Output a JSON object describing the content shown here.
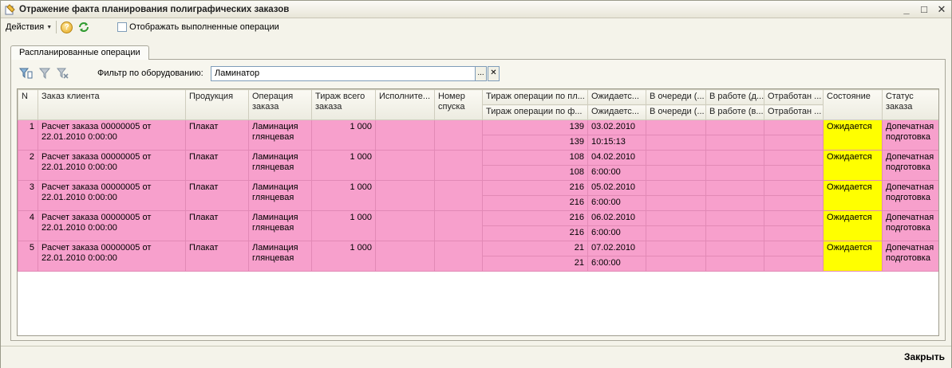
{
  "window": {
    "title": "Отражение факта планирования полиграфических заказов",
    "buttons": [
      "_",
      "□",
      "✕"
    ]
  },
  "toolbar": {
    "actions_label": "Действия",
    "help_glyph": "?",
    "show_completed_label": "Отображать выполненные операции"
  },
  "tab": {
    "label": "Распланированные операции"
  },
  "filter": {
    "label": "Фильтр по оборудованию:",
    "value": "Ламинатор",
    "select_glyph": "...",
    "clear_glyph": "✕"
  },
  "table": {
    "headers": {
      "n": "N",
      "client_order": "Заказ клиента",
      "product": "Продукция",
      "operation": "Операция заказа",
      "order_run": "Тираж всего заказа",
      "executor": "Исполните...",
      "release_no": "Номер спуска",
      "op_run_plan": "Тираж операции по пл...",
      "op_run_fact": "Тираж операции по ф...",
      "expected_1": "Ожидаетс...",
      "expected_2": "Ожидаетс...",
      "queue_1": "В очереди (...",
      "queue_2": "В очереди (...",
      "inwork_1": "В работе (д...",
      "inwork_2": "В работе (в...",
      "done_1": "Отработан ...",
      "done_2": "Отработан ...",
      "state": "Состояние",
      "order_status": "Статус заказа"
    },
    "rows": [
      {
        "n": "1",
        "order": "Расчет заказа 00000005 от 22.01.2010 0:00:00",
        "product": "Плакат",
        "operation": "Ламинация глянцевая",
        "run": "1 000",
        "plan": "139",
        "fact": "139",
        "exp_date": "03.02.2010",
        "exp_time": "10:15:13",
        "state": "Ожидается",
        "status": "Допечатная подготовка"
      },
      {
        "n": "2",
        "order": "Расчет заказа 00000005 от 22.01.2010 0:00:00",
        "product": "Плакат",
        "operation": "Ламинация глянцевая",
        "run": "1 000",
        "plan": "108",
        "fact": "108",
        "exp_date": "04.02.2010",
        "exp_time": "6:00:00",
        "state": "Ожидается",
        "status": "Допечатная подготовка"
      },
      {
        "n": "3",
        "order": "Расчет заказа 00000005 от 22.01.2010 0:00:00",
        "product": "Плакат",
        "operation": "Ламинация глянцевая",
        "run": "1 000",
        "plan": "216",
        "fact": "216",
        "exp_date": "05.02.2010",
        "exp_time": "6:00:00",
        "state": "Ожидается",
        "status": "Допечатная подготовка"
      },
      {
        "n": "4",
        "order": "Расчет заказа 00000005 от 22.01.2010 0:00:00",
        "product": "Плакат",
        "operation": "Ламинация глянцевая",
        "run": "1 000",
        "plan": "216",
        "fact": "216",
        "exp_date": "06.02.2010",
        "exp_time": "6:00:00",
        "state": "Ожидается",
        "status": "Допечатная подготовка"
      },
      {
        "n": "5",
        "order": "Расчет заказа 00000005 от 22.01.2010 0:00:00",
        "product": "Плакат",
        "operation": "Ламинация глянцевая",
        "run": "1 000",
        "plan": "21",
        "fact": "21",
        "exp_date": "07.02.2010",
        "exp_time": "6:00:00",
        "state": "Ожидается",
        "status": "Допечатная подготовка"
      }
    ]
  },
  "footer": {
    "close_label": "Закрыть"
  },
  "colors": {
    "row_bg": "#f7a0cc",
    "state_bg": "#ffff00"
  }
}
